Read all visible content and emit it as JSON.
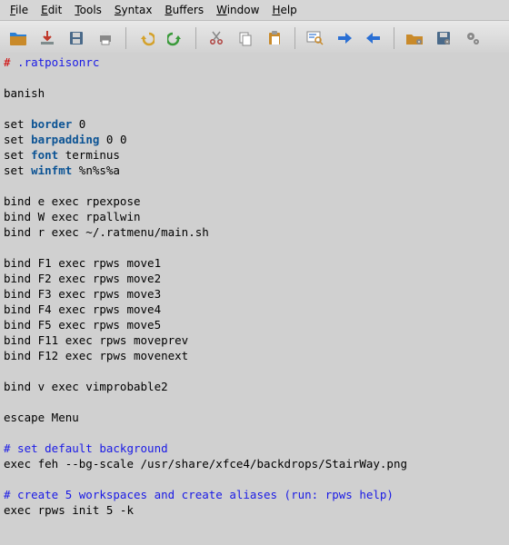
{
  "menu": {
    "file": "File",
    "edit": "Edit",
    "tools": "Tools",
    "syntax": "Syntax",
    "buffers": "Buffers",
    "window": "Window",
    "help": "Help"
  },
  "toolbar_icons": {
    "open": "open-icon",
    "download": "download-icon",
    "save": "save-icon",
    "print": "print-icon",
    "undo": "undo-icon",
    "redo": "redo-icon",
    "cut": "cut-icon",
    "copy": "copy-icon",
    "paste": "paste-icon",
    "find": "find-replace-icon",
    "prev": "arrow-right-icon",
    "next": "arrow-left-icon",
    "plugin1": "folder-gear-icon",
    "plugin2": "save-gear-icon",
    "plugin3": "gears-icon"
  },
  "code": {
    "l1a": "#",
    "l1b": " .ratpoisonrc",
    "l2": "",
    "l3": "banish",
    "l4": "",
    "l5a": "set ",
    "l5b": "border",
    "l5c": " 0",
    "l6a": "set ",
    "l6b": "barpadding",
    "l6c": " 0 0",
    "l7a": "set ",
    "l7b": "font",
    "l7c": " terminus",
    "l8a": "set ",
    "l8b": "winfmt",
    "l8c": " %n%s%a",
    "l9": "",
    "l10": "bind e exec rpexpose",
    "l11": "bind W exec rpallwin",
    "l12": "bind r exec ~/.ratmenu/main.sh",
    "l13": "",
    "l14": "bind F1 exec rpws move1",
    "l15": "bind F2 exec rpws move2",
    "l16": "bind F3 exec rpws move3",
    "l17": "bind F4 exec rpws move4",
    "l18": "bind F5 exec rpws move5",
    "l19": "bind F11 exec rpws moveprev",
    "l20": "bind F12 exec rpws movenext",
    "l21": "",
    "l22": "bind v exec vimprobable2",
    "l23": "",
    "l24": "escape Menu",
    "l25": "",
    "l26": "# set default background",
    "l27": "exec feh --bg-scale /usr/share/xfce4/backdrops/StairWay.png",
    "l28": "",
    "l29": "# create 5 workspaces and create aliases (run: rpws help)",
    "l30": "exec rpws init 5 -k"
  }
}
